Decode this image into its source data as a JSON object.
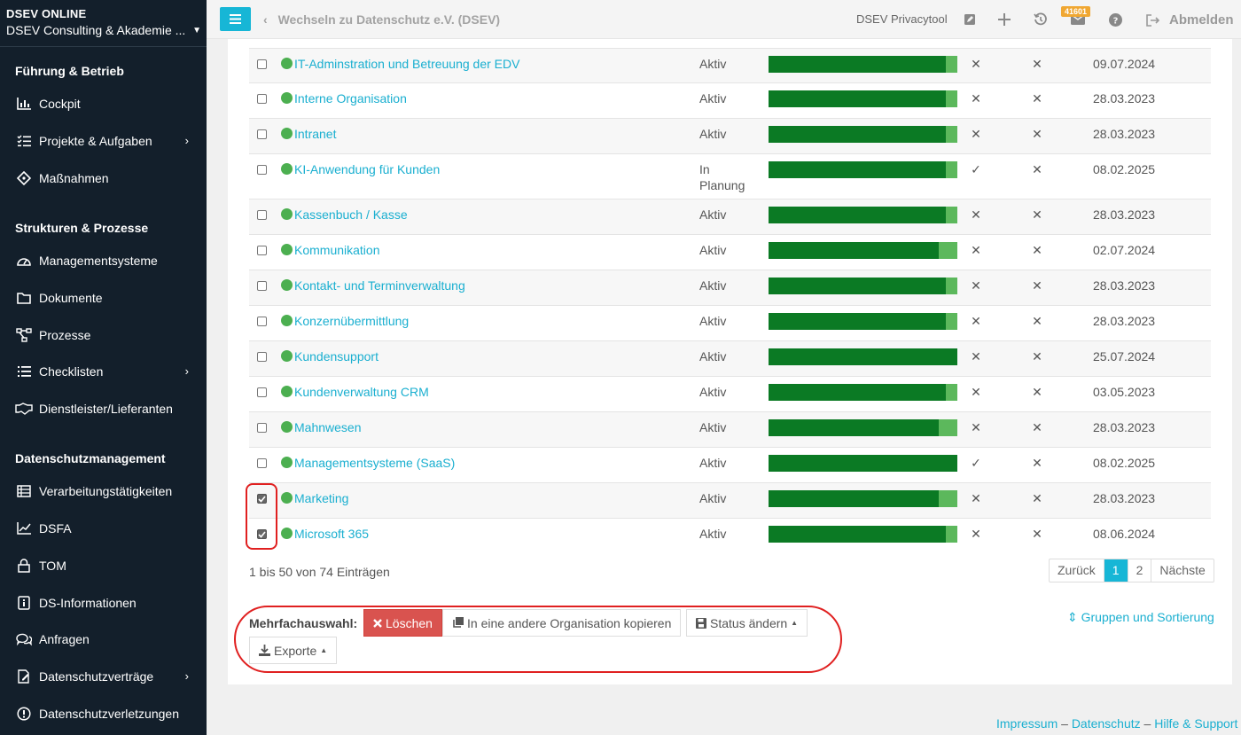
{
  "brand": {
    "title": "DSEV ONLINE",
    "org": "DSEV Consulting & Akademie ..."
  },
  "sidebar": {
    "sections": [
      {
        "title": "Führung & Betrieb"
      },
      {
        "title": "Strukturen & Prozesse"
      },
      {
        "title": "Datenschutzmanagement"
      }
    ],
    "items": [
      {
        "label": "Cockpit",
        "icon": "bar-chart-icon"
      },
      {
        "label": "Projekte & Aufgaben",
        "icon": "tasks-icon",
        "submenu": true
      },
      {
        "label": "Maßnahmen",
        "icon": "diamond-icon"
      },
      {
        "label": "Managementsysteme",
        "icon": "gauge-icon"
      },
      {
        "label": "Dokumente",
        "icon": "folder-icon"
      },
      {
        "label": "Prozesse",
        "icon": "flow-icon"
      },
      {
        "label": "Checklisten",
        "icon": "list-icon",
        "submenu": true
      },
      {
        "label": "Dienstleister/Lieferanten",
        "icon": "handshake-icon"
      },
      {
        "label": "Verarbeitungstätigkeiten",
        "icon": "table-icon"
      },
      {
        "label": "DSFA",
        "icon": "line-chart-icon"
      },
      {
        "label": "TOM",
        "icon": "lock-icon"
      },
      {
        "label": "DS-Informationen",
        "icon": "info-icon"
      },
      {
        "label": "Anfragen",
        "icon": "chat-icon"
      },
      {
        "label": "Datenschutzverträge",
        "icon": "contract-icon",
        "submenu": true
      },
      {
        "label": "Datenschutzverletzungen",
        "icon": "alert-icon"
      }
    ]
  },
  "topbar": {
    "switch_org": "Wechseln zu Datenschutz e.V. (DSEV)",
    "privacytool": "DSEV Privacytool",
    "badge": "41601",
    "logout": "Abmelden"
  },
  "rows": [
    {
      "name": "IT-Adminstration und Betreuung der EDV",
      "status": "Aktiv",
      "progress": 0.94,
      "mark1": "✕",
      "mark2": "✕",
      "date": "09.07.2024",
      "checked": false
    },
    {
      "name": "Interne Organisation",
      "status": "Aktiv",
      "progress": 0.94,
      "mark1": "✕",
      "mark2": "✕",
      "date": "28.03.2023",
      "checked": false
    },
    {
      "name": "Intranet",
      "status": "Aktiv",
      "progress": 0.94,
      "mark1": "✕",
      "mark2": "✕",
      "date": "28.03.2023",
      "checked": false
    },
    {
      "name": "KI-Anwendung für Kunden",
      "status": "In Planung",
      "progress": 0.94,
      "mark1": "✓",
      "mark2": "✕",
      "date": "08.02.2025",
      "checked": false
    },
    {
      "name": "Kassenbuch / Kasse",
      "status": "Aktiv",
      "progress": 0.94,
      "mark1": "✕",
      "mark2": "✕",
      "date": "28.03.2023",
      "checked": false
    },
    {
      "name": "Kommunikation",
      "status": "Aktiv",
      "progress": 0.9,
      "mark1": "✕",
      "mark2": "✕",
      "date": "02.07.2024",
      "checked": false
    },
    {
      "name": "Kontakt- und Terminverwaltung",
      "status": "Aktiv",
      "progress": 0.94,
      "mark1": "✕",
      "mark2": "✕",
      "date": "28.03.2023",
      "checked": false
    },
    {
      "name": "Konzernübermittlung",
      "status": "Aktiv",
      "progress": 0.94,
      "mark1": "✕",
      "mark2": "✕",
      "date": "28.03.2023",
      "checked": false
    },
    {
      "name": "Kundensupport",
      "status": "Aktiv",
      "progress": 1.0,
      "mark1": "✕",
      "mark2": "✕",
      "date": "25.07.2024",
      "checked": false
    },
    {
      "name": "Kundenverwaltung CRM",
      "status": "Aktiv",
      "progress": 0.94,
      "mark1": "✕",
      "mark2": "✕",
      "date": "03.05.2023",
      "checked": false
    },
    {
      "name": "Mahnwesen",
      "status": "Aktiv",
      "progress": 0.9,
      "mark1": "✕",
      "mark2": "✕",
      "date": "28.03.2023",
      "checked": false
    },
    {
      "name": "Managementsysteme (SaaS)",
      "status": "Aktiv",
      "progress": 1.0,
      "mark1": "✓",
      "mark2": "✕",
      "date": "08.02.2025",
      "checked": false
    },
    {
      "name": "Marketing",
      "status": "Aktiv",
      "progress": 0.9,
      "mark1": "✕",
      "mark2": "✕",
      "date": "28.03.2023",
      "checked": true
    },
    {
      "name": "Microsoft 365",
      "status": "Aktiv",
      "progress": 0.94,
      "mark1": "✕",
      "mark2": "✕",
      "date": "08.06.2024",
      "checked": true
    }
  ],
  "table_info": "1 bis 50 von 74 Einträgen",
  "pagination": {
    "prev": "Zurück",
    "pages": [
      "1",
      "2"
    ],
    "current": "1",
    "next": "Nächste"
  },
  "bulk": {
    "label": "Mehrfachauswahl:",
    "delete": "Löschen",
    "copy": "In eine andere Organisation kopieren",
    "status": "Status ändern",
    "exports": "Exporte"
  },
  "grouping": "Gruppen und Sortierung",
  "footer": {
    "impressum": "Impressum",
    "datenschutz": "Datenschutz",
    "hilfe": "Hilfe & Support",
    "sep": "–"
  },
  "colors": {
    "accent": "#17b6d6",
    "link": "#1aafd0",
    "danger": "#d9534f",
    "sidebar": "#131f2b",
    "progress_dark": "#0b7a24",
    "progress_light": "#5cb85c",
    "dot": "#4caf50",
    "highlight": "#e02020"
  }
}
